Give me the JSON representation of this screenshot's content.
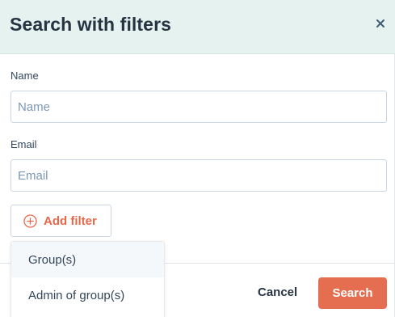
{
  "header": {
    "title": "Search with filters",
    "close_icon": "close-icon"
  },
  "form": {
    "name_label": "Name",
    "name_placeholder": "Name",
    "name_value": "",
    "email_label": "Email",
    "email_placeholder": "Email",
    "email_value": ""
  },
  "add_filter": {
    "label": "Add filter",
    "icon": "plus-circle-icon"
  },
  "dropdown": {
    "items": [
      {
        "label": "Group(s)",
        "hovered": true
      },
      {
        "label": "Admin of group(s)",
        "hovered": false
      }
    ]
  },
  "footer": {
    "cancel_label": "Cancel",
    "search_label": "Search"
  },
  "colors": {
    "header_bg": "#e6f2ef",
    "accent": "#e66e50",
    "accent_text": "#e8674a",
    "text_dark": "#253342"
  }
}
